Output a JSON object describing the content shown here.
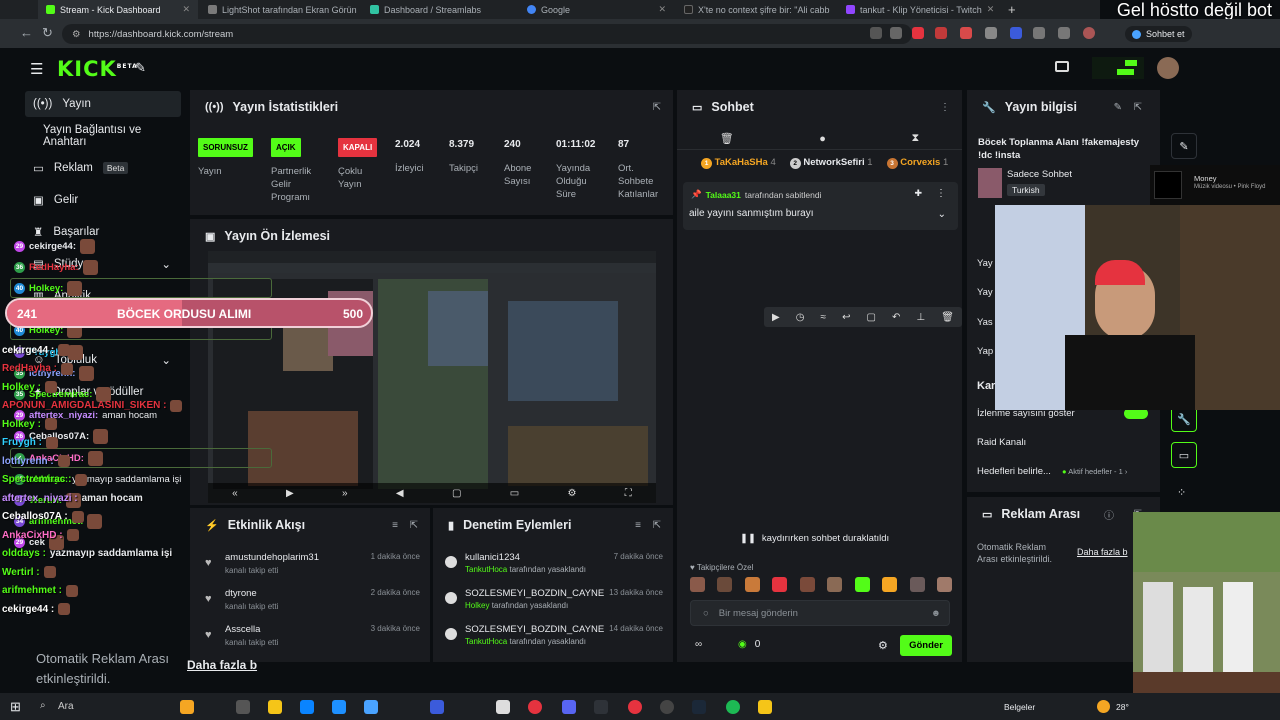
{
  "browser": {
    "tabs": [
      {
        "label": "Stream - Kick Dashboard",
        "color": "#53fc18"
      },
      {
        "label": "LightShot tarafından Ekran Görün",
        "color": "#7a7a7a"
      },
      {
        "label": "Dashboard / Streamlabs",
        "color": "#31c3a2"
      },
      {
        "label": "Google",
        "color": "#4285f4"
      },
      {
        "label": "X'te no context şifre bir: \"Ali cabb",
        "color": "#222222"
      },
      {
        "label": "tankut - Klip Yöneticisi - Twitch",
        "color": "#9146ff"
      }
    ],
    "url": "https://dashboard.kick.com/stream",
    "profile_label": "Sohbet et",
    "overlay_title": "Gel höstto değil bot"
  },
  "sidebar": {
    "items": [
      {
        "label": "Yayın",
        "icon": "broadcast-icon"
      },
      {
        "label": "Yayın Bağlantısı ve Anahtarı",
        "icon": ""
      },
      {
        "label": "Reklam",
        "icon": "ad-icon",
        "badge": "Beta"
      },
      {
        "label": "Gelir",
        "icon": "wallet-icon"
      },
      {
        "label": "Başarılar",
        "icon": "trophy-icon"
      },
      {
        "label": "Stüdyo",
        "icon": "studio-icon"
      },
      {
        "label": "Analitik",
        "icon": "chart-icon"
      },
      {
        "label": "Topluluk",
        "icon": "users-icon"
      },
      {
        "label": "Droplar ve ödüller",
        "icon": "gift-icon"
      }
    ]
  },
  "stats": {
    "title": "Yayın İstatistikleri",
    "items": [
      {
        "pill": "SORUNSUZ",
        "label": "Yayın",
        "pill_color": "#53fc18"
      },
      {
        "pill": "AÇIK",
        "label": "Partnerlik Gelir Programı",
        "pill_color": "#53fc18"
      },
      {
        "pill": "KAPALI",
        "label": "Çoklu Yayın",
        "pill_color": "#e5333f"
      },
      {
        "value": "2.024",
        "label": "İzleyici"
      },
      {
        "value": "8.379",
        "label": "Takipçi"
      },
      {
        "value": "240",
        "label": "Abone Sayısı"
      },
      {
        "value": "01:11:02",
        "label": "Yayında Olduğu Süre"
      },
      {
        "value": "87",
        "label": "Ort. Sohbete Katılanlar"
      }
    ]
  },
  "preview": {
    "title": "Yayın Ön İzlemesi"
  },
  "activity": {
    "title": "Etkinlik Akışı",
    "rows": [
      {
        "name": "amustundehoplarim31",
        "sub": "kanalı takip etti",
        "time": "1 dakika önce"
      },
      {
        "name": "dtyrone",
        "sub": "kanalı takip etti",
        "time": "2 dakika önce"
      },
      {
        "name": "Asscella",
        "sub": "kanalı takip etti",
        "time": "3 dakika önce"
      }
    ]
  },
  "moderation": {
    "title": "Denetim Eylemleri",
    "rows": [
      {
        "name": "kullanici1234",
        "by": "TankutHoca",
        "sub": "tarafından yasaklandı",
        "time": "7 dakika önce"
      },
      {
        "name": "SOZLESMEYI_BOZDIN_CAYNE",
        "by": "Holkey",
        "sub": "tarafından yasaklandı",
        "time": "13 dakika önce"
      },
      {
        "name": "SOZLESMEYI_BOZDIN_CAYNE",
        "by": "TankutHoca",
        "sub": "tarafından yasaklandı",
        "time": "14 dakika önce"
      }
    ]
  },
  "chat": {
    "title": "Sohbet",
    "top_gifters": [
      {
        "name": "TaKaHaSHa",
        "count": "4",
        "color": "#f5a623"
      },
      {
        "name": "NetworkSefiri",
        "count": "1",
        "color": "#e8eaed"
      },
      {
        "name": "Corvexis",
        "count": "1",
        "color": "#f5a623"
      }
    ],
    "pinned_by": "Talaaa31",
    "pinned_by_suffix": "tarafından sabitlendi",
    "pinned_text": "aile yayını sanmıştım burayı",
    "lines": [
      {
        "badge": "29",
        "user": "cekirge44:",
        "color": "#e8eaed",
        "msg": ""
      },
      {
        "badge": "36",
        "user": "RedHayha:",
        "color": "#e5333f",
        "msg": ""
      },
      {
        "badge": "40",
        "user": "Holkey:",
        "color": "#53fc18",
        "msg": "",
        "hl": true
      },
      {
        "badge": "29",
        "user": "APONUN_",
        "color": "#e5333f",
        "msg": ""
      },
      {
        "badge": "40",
        "user": "Holkey:",
        "color": "#53fc18",
        "msg": "",
        "hl": true
      },
      {
        "badge": "37",
        "user": "Fruygh:",
        "color": "#2fd0ff",
        "msg": ""
      },
      {
        "badge": "35",
        "user": "lothyrenn:",
        "color": "#8da3ff",
        "msg": ""
      },
      {
        "badge": "35",
        "user": "Spectremirac:",
        "color": "#53fc18",
        "msg": ""
      },
      {
        "badge": "29",
        "user": "aftertex_niyazi:",
        "color": "#c68cff",
        "msg": "aman hocam"
      },
      {
        "badge": "26",
        "user": "Ceballos07A:",
        "color": "#e8eaed",
        "msg": ""
      },
      {
        "badge": "✓",
        "user": "AnkaCixHD:",
        "color": "#ff6ec7",
        "msg": "",
        "hl": true
      },
      {
        "badge": "45",
        "user": "olddays:",
        "color": "#53fc18",
        "msg": "yazmayıp saddamlama işi"
      },
      {
        "badge": "32",
        "user": "Wertirl:",
        "color": "#53fc18",
        "msg": ""
      },
      {
        "badge": "34",
        "user": "arifmehmet:",
        "color": "#53fc18",
        "msg": ""
      },
      {
        "badge": "29",
        "user": "cek",
        "color": "#e8eaed",
        "msg": ""
      }
    ],
    "paused_text": "kaydırırken sohbet duraklatıldı",
    "subs_only_label": "Takipçilere Özel",
    "input_placeholder": "Bir mesaj gönderin",
    "count": "0",
    "send_label": "Gönder"
  },
  "info": {
    "title": "Yayın bilgisi",
    "stream_title": "Böcek Toplanma Alanı !fakemajesty !dc !insta",
    "category": "Sadece Sohbet",
    "language": "Turkish",
    "rows": [
      "Yay",
      "Yay",
      "Yas",
      "Yap",
      "Kar"
    ],
    "view_count_label": "İzlenme sayısını göster",
    "raid_label": "Raid Kanalı",
    "goals_label": "Hedefleri belirle...",
    "active_goals": "Aktif hedefler - 1"
  },
  "adbreak": {
    "title": "Reklam Arası",
    "text": "Otomatik Reklam Arası etkinleştirildi.",
    "link": "Daha fazla b"
  },
  "overlay": {
    "goal_left": "241",
    "goal_label": "BÖCEK ORDUSU ALIMI",
    "goal_right": "500",
    "goal_progress": 0.482,
    "lines": [
      {
        "user": "cekirge44 :",
        "color": "#ffffff",
        "msg": ""
      },
      {
        "user": "RedHayha :",
        "color": "#e5333f",
        "msg": ""
      },
      {
        "user": "Holkey :",
        "color": "#53fc18",
        "msg": ""
      },
      {
        "user": "APONUN_AMIGDALASINI_SIKEN :",
        "color": "#e5333f",
        "msg": ""
      },
      {
        "user": "Holkey :",
        "color": "#53fc18",
        "msg": ""
      },
      {
        "user": "Fruygh :",
        "color": "#2fd0ff",
        "msg": ""
      },
      {
        "user": "lothyrenn :",
        "color": "#8da3ff",
        "msg": ""
      },
      {
        "user": "Spectremirac :",
        "color": "#53fc18",
        "msg": ""
      },
      {
        "user": "aftertex_niyazi :",
        "color": "#c68cff",
        "msg": "aman hocam"
      },
      {
        "user": "Ceballos07A :",
        "color": "#ffffff",
        "msg": ""
      },
      {
        "user": "AnkaCixHD :",
        "color": "#ff6ec7",
        "msg": ""
      },
      {
        "user": "olddays :",
        "color": "#53fc18",
        "msg": "yazmayıp saddamlama işi"
      },
      {
        "user": "Wertirl :",
        "color": "#53fc18",
        "msg": ""
      },
      {
        "user": "arifmehmet :",
        "color": "#53fc18",
        "msg": ""
      },
      {
        "user": "cekirge44 :",
        "color": "#ffffff",
        "msg": ""
      }
    ],
    "ad_text": "Otomatik Reklam Arası etkinleştirildi.",
    "ad_link": "Daha fazla b"
  },
  "spotify": {
    "title": "Money",
    "sub": "Müzik videosu • Pink Floyd"
  },
  "taskbar": {
    "search": "Ara",
    "tray_label": "Belgeler",
    "temp": "28°"
  },
  "colors": {
    "accent": "#53fc18",
    "bg": "#0b0e11",
    "panel": "#191b1f"
  }
}
